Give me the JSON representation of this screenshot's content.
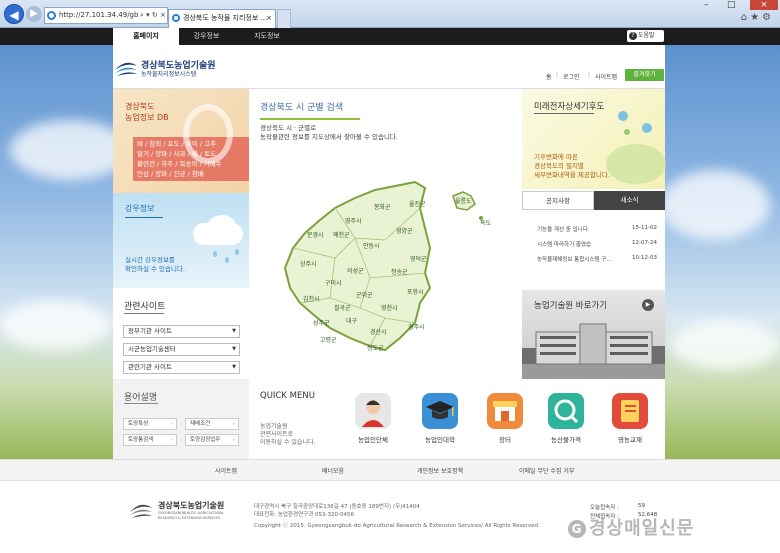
{
  "browser": {
    "address": "http://27.101.34.49/gbcrop/",
    "address_controls": "⌕ ▾ ↻ ×",
    "active_tab": "경상북도 농작물 지리정보 ...",
    "tab_close": "×"
  },
  "topnav": {
    "items": [
      "홈페이지",
      "강우정보",
      "지도정보"
    ],
    "help": "도움말"
  },
  "logo": {
    "title": "경상북도농업기술원",
    "subtitle": "농작물지리정보시스템"
  },
  "util": {
    "home": "홈",
    "login": "로그인",
    "sitemap": "사이트맵",
    "favorite": "즐겨찾기"
  },
  "db_panel": {
    "title_line1": "경상북도",
    "title_line2": "농업정보 DB",
    "items_line1": "벼 / 참외 / 포도 / 오이 / 고추",
    "items_line2": "딸기 / 양파 / 사과 / 배 / 토도",
    "items_line3": "황련건 / 하주 / 복숭아 / 가배수",
    "items_line4": "인삼 / 양파 / 잔균 / 참배"
  },
  "rain_panel": {
    "title": "강우정보",
    "desc_line1": "실시간 강우정보를",
    "desc_line2": "확인하실 수 있습니다."
  },
  "related": {
    "title": "관련사이트",
    "selects": [
      "정부기관 사이트",
      "시군농업기술센터",
      "관련기관 사이트"
    ]
  },
  "terms": {
    "title": "용어설명",
    "buttons": [
      "토양특성",
      "재배조건",
      "토양통검색",
      "토양검정업무"
    ]
  },
  "map_section": {
    "title": "경상북도 시 군별 검색",
    "sub_line1": "경상북도 시 · 군별로",
    "sub_line2": "농작물관련 정보를 지도상에서 찾아볼 수 있습니다.",
    "regions": [
      "봉화군",
      "울진군",
      "영주시",
      "영양군",
      "울릉도",
      "독도",
      "문경시",
      "예천군",
      "안동시",
      "청송군",
      "영덕군",
      "상주시",
      "의성군",
      "포항시",
      "구미시",
      "군위군",
      "칠곡군",
      "김천시",
      "영천시",
      "경주시",
      "성주군",
      "고령군",
      "청도군",
      "경산시",
      "대구"
    ]
  },
  "future": {
    "title": "미래전자상세기후도",
    "desc_line1": "기후변화에 따른",
    "desc_line2": "경상북도의 필지별",
    "desc_line3": "세부변화내역을 제공합니다."
  },
  "notices": {
    "tabs": [
      "공지사항",
      "새소식"
    ],
    "items": [
      {
        "title": "기능을 개선 중 입니다.",
        "date": "15-11-02"
      },
      {
        "title": "시스템 마라하기 줄였습",
        "date": "12-07-24"
      },
      {
        "title": "농작물재해정보 통합시스템 구...",
        "date": "10-12-03"
      }
    ]
  },
  "agri_building": {
    "title": "농업기술원 바로가기",
    "arrow": "▶"
  },
  "quick_menu": {
    "title": "QUICK MENU",
    "desc_line1": "농업기술원",
    "desc_line2": "관련사이트로",
    "desc_line3": "이동하실 수 있습니다.",
    "items": [
      "농업인단체",
      "농업인대학",
      "장터",
      "농산물가격",
      "영농교재"
    ]
  },
  "footer_nav": [
    "사이트맵",
    "배너모음",
    "개인정보 보호정책",
    "이메일 무단 수집 거부"
  ],
  "footer": {
    "logo_title": "경상북도농업기술원",
    "logo_sub1": "GYEONGSANGBUK-DO AGRICULTURAL",
    "logo_sub2": "RESEARCH & EXTENSION SERVICES",
    "address": "대구광역시 북구 칠곡중앙대로136길 47 (동호동 189번지) (우)41404",
    "phone": "대표전화: 농업환경연구과 053-320-0456",
    "copyright": "Copyright ⓒ 2015. Gyeongsangbuk-do Agricultural Research & Extension Services/ All Rights Reserved.",
    "today_label": "오늘접속자 :",
    "today_value": "59",
    "total_label": "전체접속자 :",
    "total_value": "52,648"
  },
  "watermark": "경상매일신문"
}
